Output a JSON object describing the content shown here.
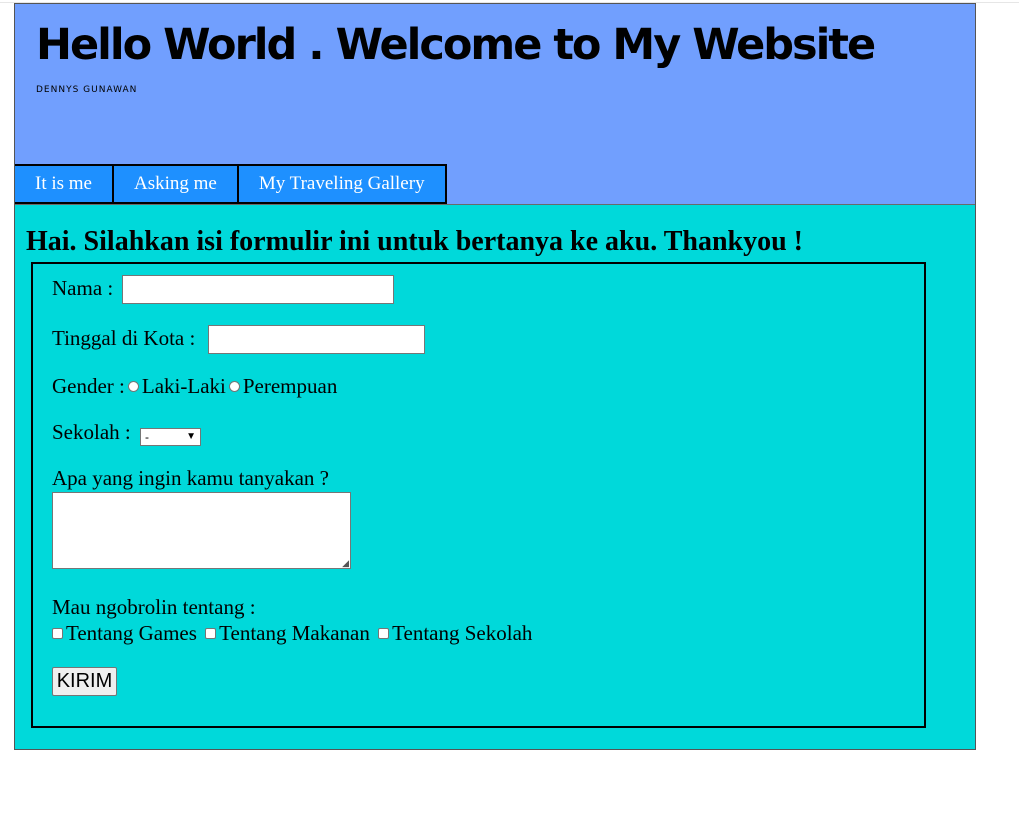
{
  "header": {
    "title": "Hello World . Welcome to My Website",
    "author": "DENNYS GUNAWAN"
  },
  "nav": {
    "items": [
      {
        "label": "It is me"
      },
      {
        "label": "Asking me"
      },
      {
        "label": "My Traveling Gallery"
      }
    ]
  },
  "form": {
    "heading": "Hai. Silahkan isi formulir ini untuk bertanya ke aku. Thankyou !",
    "name_label": "Nama :",
    "name_value": "",
    "city_label": "Tinggal di Kota :",
    "city_value": "",
    "gender_label": "Gender :",
    "gender_options": [
      "Laki-Laki",
      "Perempuan"
    ],
    "school_label": "Sekolah :",
    "school_selected": "-",
    "question_label": "Apa yang ingin kamu tanyakan ?",
    "question_value": "",
    "topics_label": "Mau ngobrolin tentang :",
    "topics": [
      "Tentang Games",
      "Tentang Makanan",
      "Tentang Sekolah"
    ],
    "submit_label": "KIRIM"
  },
  "colors": {
    "header_bg": "#719ffe",
    "body_bg": "#00d9da",
    "nav_bg": "#1e90ff"
  }
}
